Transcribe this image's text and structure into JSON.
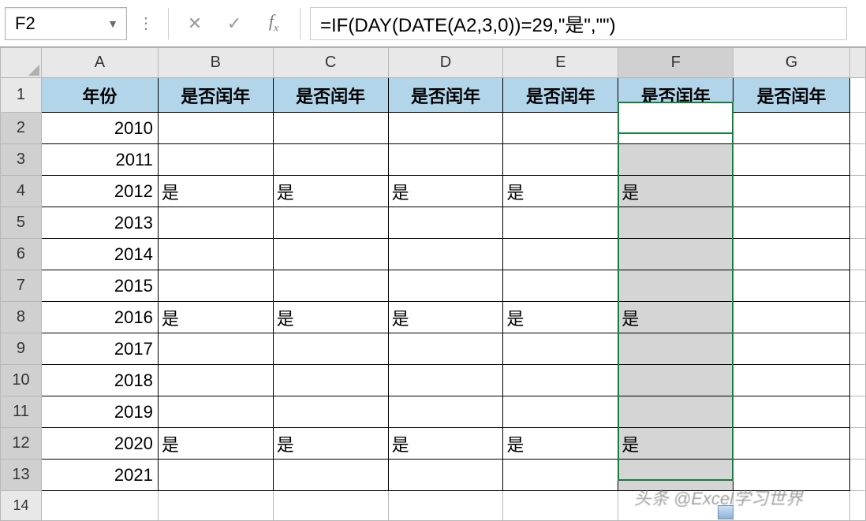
{
  "active_cell": "F2",
  "formula": "=IF(DAY(DATE(A2,3,0))=29,\"是\",\"\")",
  "columns": [
    "A",
    "B",
    "C",
    "D",
    "E",
    "F",
    "G"
  ],
  "col_widths": {
    "rowhdr": 52,
    "A": 148,
    "B": 146,
    "C": 146,
    "D": 146,
    "E": 146,
    "F": 146,
    "G": 148,
    "extra": 20
  },
  "header_row": {
    "A": "年份",
    "B": "是否闰年",
    "C": "是否闰年",
    "D": "是否闰年",
    "E": "是否闰年",
    "F": "是否闰年",
    "G": "是否闰年"
  },
  "rows": [
    {
      "n": 2,
      "A": "2010",
      "B": "",
      "C": "",
      "D": "",
      "E": "",
      "F": "",
      "G": ""
    },
    {
      "n": 3,
      "A": "2011",
      "B": "",
      "C": "",
      "D": "",
      "E": "",
      "F": "",
      "G": ""
    },
    {
      "n": 4,
      "A": "2012",
      "B": "是",
      "C": "是",
      "D": "是",
      "E": "是",
      "F": "是",
      "G": ""
    },
    {
      "n": 5,
      "A": "2013",
      "B": "",
      "C": "",
      "D": "",
      "E": "",
      "F": "",
      "G": ""
    },
    {
      "n": 6,
      "A": "2014",
      "B": "",
      "C": "",
      "D": "",
      "E": "",
      "F": "",
      "G": ""
    },
    {
      "n": 7,
      "A": "2015",
      "B": "",
      "C": "",
      "D": "",
      "E": "",
      "F": "",
      "G": ""
    },
    {
      "n": 8,
      "A": "2016",
      "B": "是",
      "C": "是",
      "D": "是",
      "E": "是",
      "F": "是",
      "G": ""
    },
    {
      "n": 9,
      "A": "2017",
      "B": "",
      "C": "",
      "D": "",
      "E": "",
      "F": "",
      "G": ""
    },
    {
      "n": 10,
      "A": "2018",
      "B": "",
      "C": "",
      "D": "",
      "E": "",
      "F": "",
      "G": ""
    },
    {
      "n": 11,
      "A": "2019",
      "B": "",
      "C": "",
      "D": "",
      "E": "",
      "F": "",
      "G": ""
    },
    {
      "n": 12,
      "A": "2020",
      "B": "是",
      "C": "是",
      "D": "是",
      "E": "是",
      "F": "是",
      "G": ""
    },
    {
      "n": 13,
      "A": "2021",
      "B": "",
      "C": "",
      "D": "",
      "E": "",
      "F": "",
      "G": ""
    }
  ],
  "extra_row": 14,
  "selected_column": "F",
  "selected_range": {
    "col": "F",
    "from": 2,
    "to": 13
  },
  "watermark": "头条 @Excel学习世界"
}
